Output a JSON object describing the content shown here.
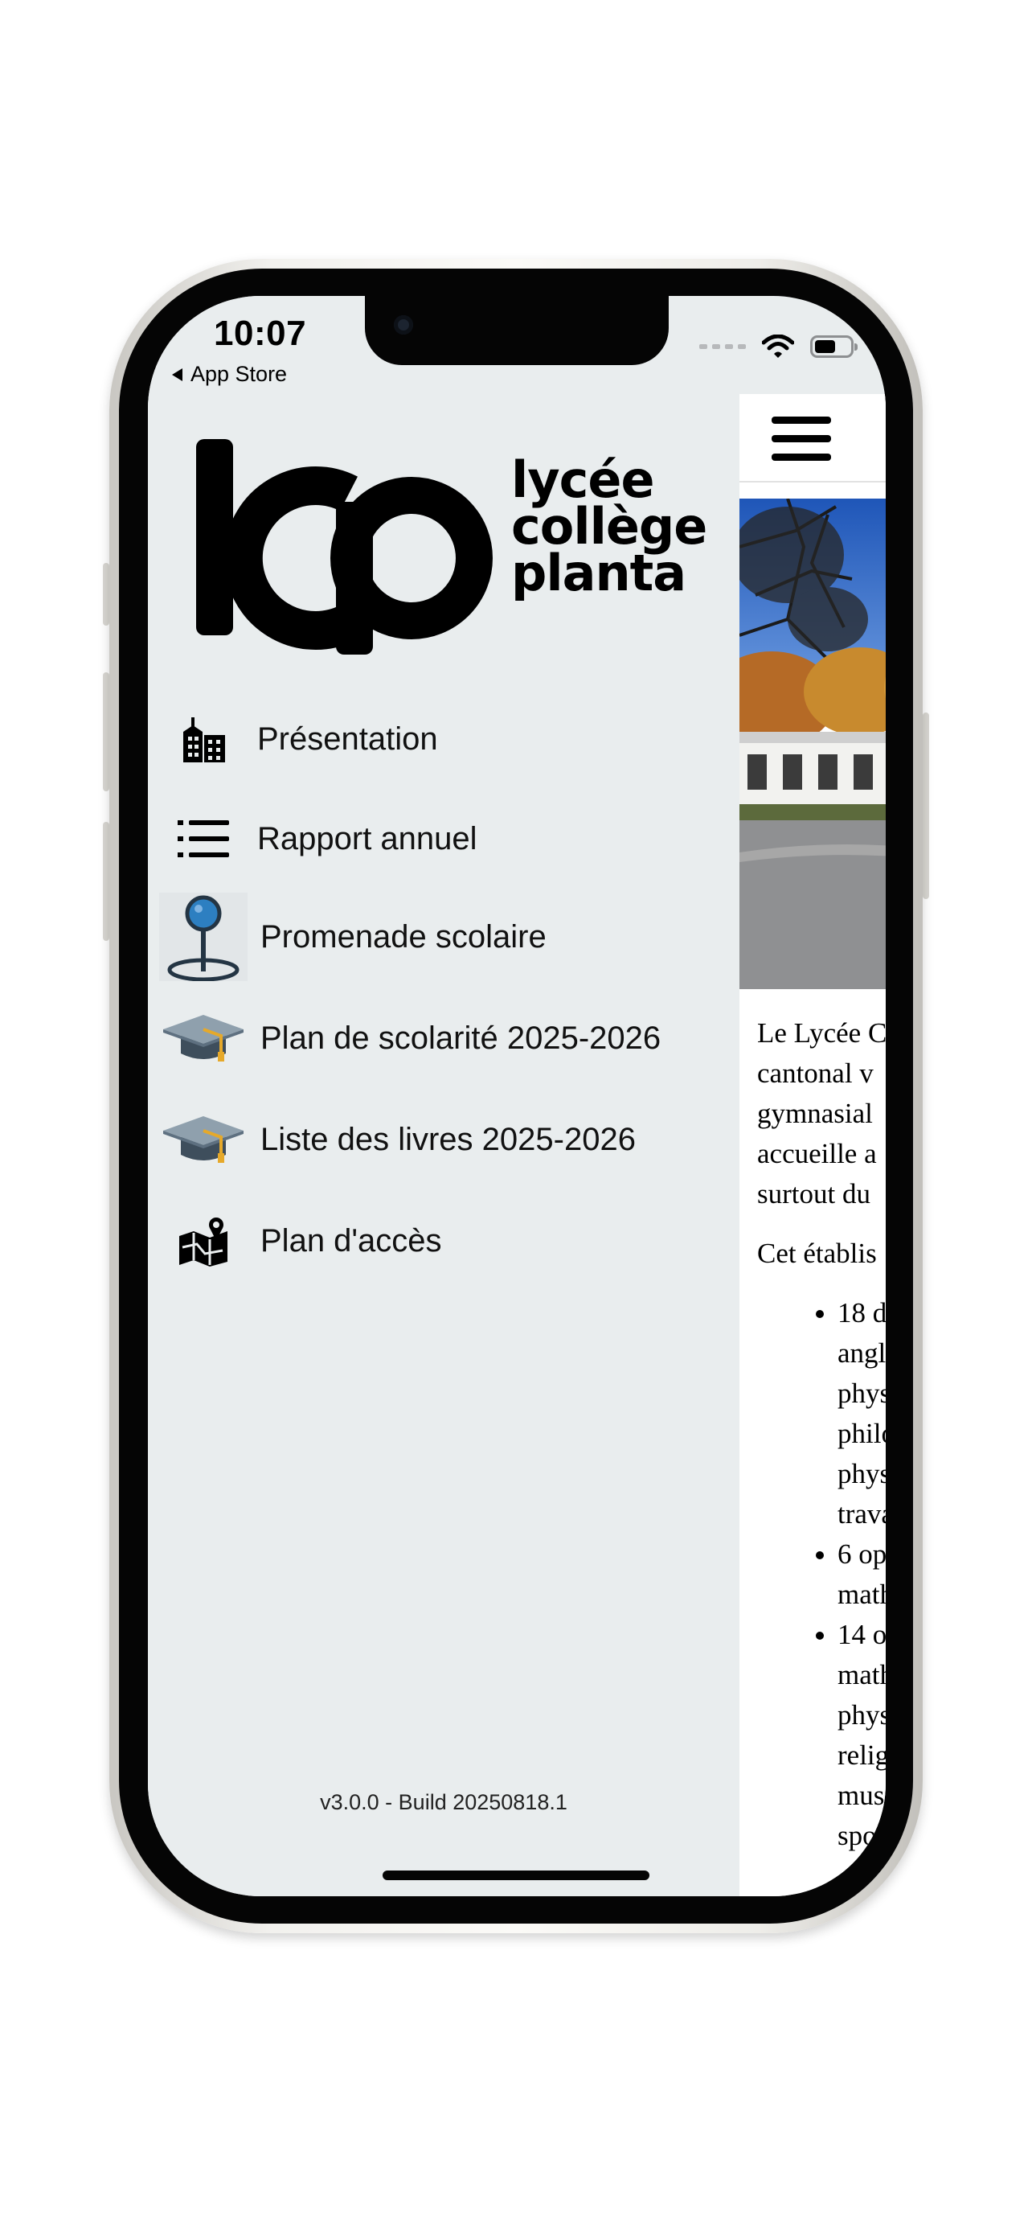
{
  "status_bar": {
    "time": "10:07",
    "back_label": "App Store",
    "battery_level": 0.6
  },
  "drawer": {
    "logo_mark": "lcp",
    "logo_lines": [
      "lycée",
      "collège",
      "planta"
    ],
    "items": [
      {
        "label": "Présentation",
        "icon": "building-icon"
      },
      {
        "label": "Rapport annuel",
        "icon": "list-icon"
      },
      {
        "label": "Promenade scolaire",
        "icon": "map-pin-icon"
      },
      {
        "label": "Plan de scolarité 2025-2026",
        "icon": "graduation-cap-icon"
      },
      {
        "label": "Liste des livres 2025-2026",
        "icon": "graduation-cap-icon"
      },
      {
        "label": "Plan d'accès",
        "icon": "map-location-icon"
      }
    ],
    "version": "v3.0.0 - Build 20250818.1"
  },
  "content": {
    "paragraph1_lines": [
      "Le Lycée C",
      "cantonal v",
      "gymnasial",
      "accueille a",
      "surtout du"
    ],
    "paragraph2": "Cet établis",
    "list": [
      {
        "lines": [
          "18 d",
          "angl",
          "phys",
          "philo",
          "phys",
          "trava"
        ]
      },
      {
        "lines": [
          "6 op",
          "math"
        ]
      },
      {
        "lines": [
          "14 o",
          "math",
          "phys",
          "relig",
          "mus",
          "spo"
        ]
      }
    ]
  },
  "colors": {
    "drawer_bg": "#e9edee",
    "content_bg": "#ffffff",
    "pin_blue": "#2d7fc1"
  }
}
